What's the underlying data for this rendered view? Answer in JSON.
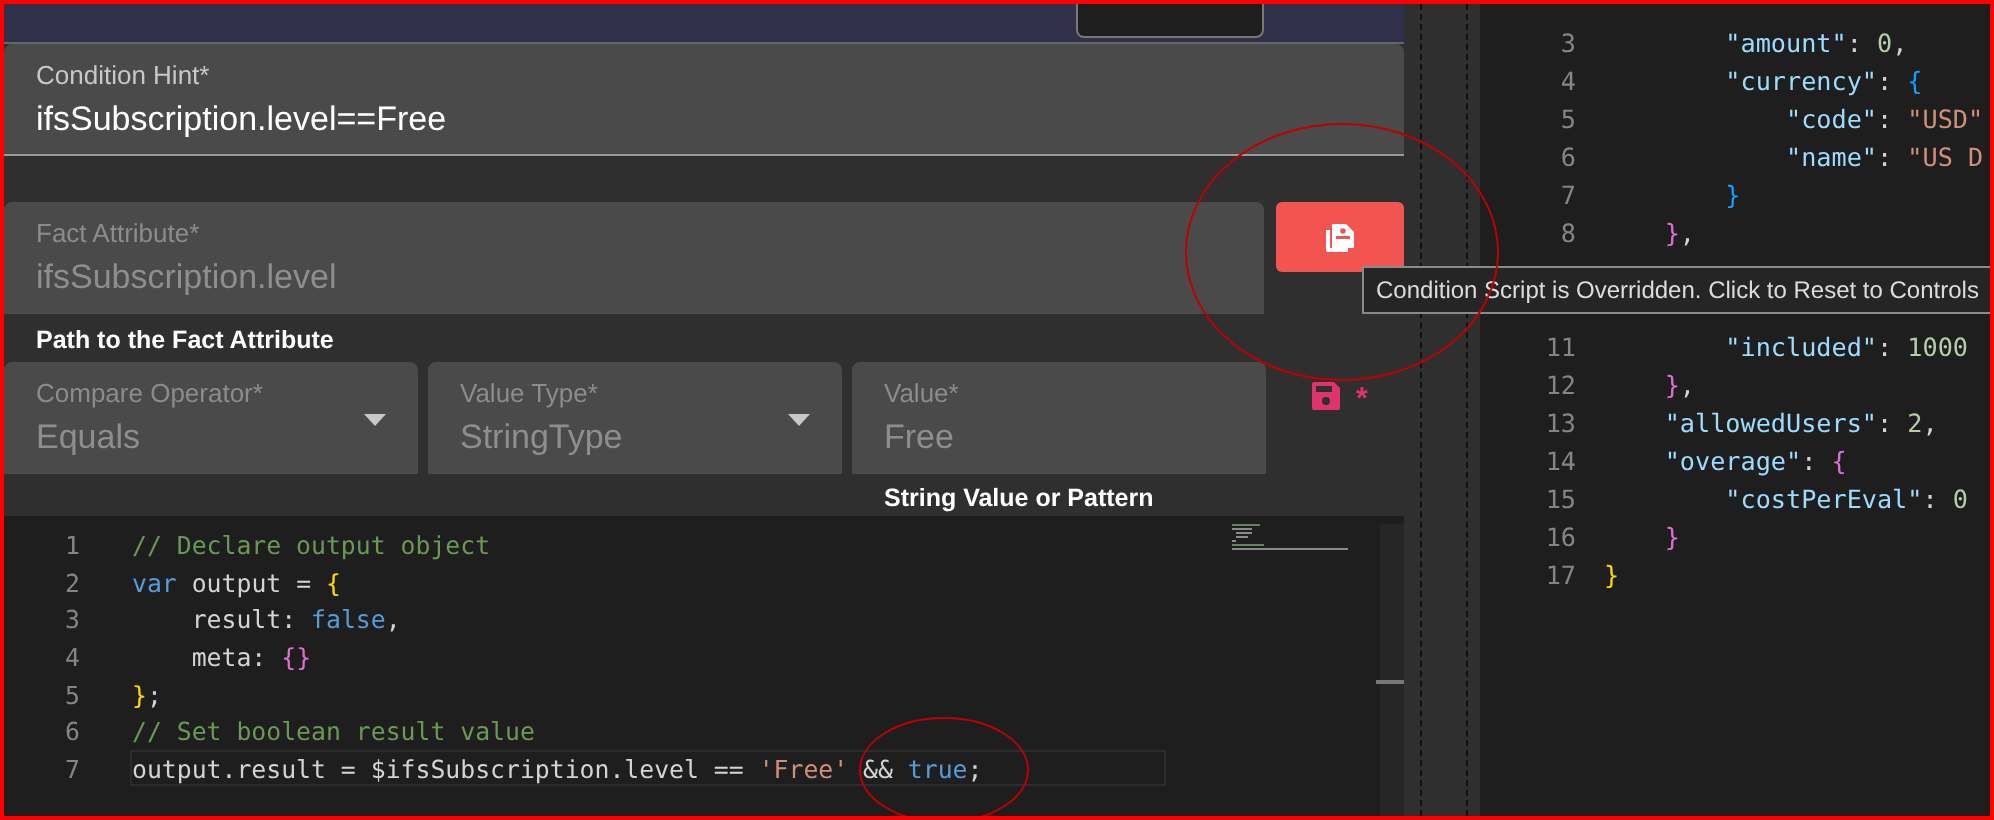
{
  "condition_hint": {
    "label": "Condition Hint*",
    "value": "ifsSubscription.level==Free",
    "disabled": false
  },
  "fact_attribute": {
    "label": "Fact Attribute*",
    "value": "ifsSubscription.level",
    "disabled": true,
    "helper": "Path to the Fact Attribute"
  },
  "reset_button": {
    "tooltip": "Condition Script is Overridden. Click to Reset to Controls"
  },
  "criteria_fields": [
    {
      "label": "Compare Operator*",
      "value": "Equals",
      "disabled": true,
      "kind": "select"
    },
    {
      "label": "Value Type*",
      "value": "StringType",
      "disabled": true,
      "kind": "select"
    },
    {
      "label": "Value*",
      "value": "Free",
      "disabled": true,
      "kind": "text",
      "helper": "String Value or Pattern"
    }
  ],
  "save_marker": "*",
  "script_editor": {
    "lines": [
      {
        "number": "1",
        "current": false,
        "tokens": [
          {
            "kind": "comment",
            "text": "// Declare output object"
          }
        ]
      },
      {
        "number": "2",
        "current": false,
        "tokens": [
          {
            "kind": "keyword",
            "text": "var"
          },
          {
            "kind": "plain",
            "text": " output = "
          },
          {
            "kind": "bracket1",
            "text": "{"
          }
        ]
      },
      {
        "number": "3",
        "current": false,
        "tokens": [
          {
            "kind": "plain",
            "text": "    result: "
          },
          {
            "kind": "keyword",
            "text": "false"
          },
          {
            "kind": "plain",
            "text": ","
          }
        ]
      },
      {
        "number": "4",
        "current": false,
        "tokens": [
          {
            "kind": "plain",
            "text": "    meta: "
          },
          {
            "kind": "bracket2",
            "text": "{}"
          }
        ]
      },
      {
        "number": "5",
        "current": false,
        "tokens": [
          {
            "kind": "bracket1",
            "text": "}"
          },
          {
            "kind": "plain",
            "text": ";"
          }
        ]
      },
      {
        "number": "6",
        "current": false,
        "tokens": [
          {
            "kind": "comment",
            "text": "// Set boolean result value"
          }
        ]
      },
      {
        "number": "7",
        "current": true,
        "tokens": [
          {
            "kind": "plain",
            "text": "output.result = $ifsSubscription.level == "
          },
          {
            "kind": "string",
            "text": "'Free'"
          },
          {
            "kind": "plain",
            "text": " && "
          },
          {
            "kind": "keyword",
            "text": "true"
          },
          {
            "kind": "plain",
            "text": ";"
          }
        ]
      }
    ]
  },
  "json_editor": {
    "lines": [
      {
        "kind": "line",
        "number": "3",
        "tokens": [
          {
            "kind": "key",
            "text": "        \"amount\""
          },
          {
            "kind": "plain",
            "text": ": "
          },
          {
            "kind": "number",
            "text": "0"
          },
          {
            "kind": "plain",
            "text": ","
          }
        ]
      },
      {
        "kind": "line",
        "number": "4",
        "tokens": [
          {
            "kind": "key",
            "text": "        \"currency\""
          },
          {
            "kind": "plain",
            "text": ": "
          },
          {
            "kind": "bracket3",
            "text": "{"
          }
        ]
      },
      {
        "kind": "line",
        "number": "5",
        "tokens": [
          {
            "kind": "key",
            "text": "            \"code\""
          },
          {
            "kind": "plain",
            "text": ": "
          },
          {
            "kind": "string",
            "text": "\"USD\""
          }
        ]
      },
      {
        "kind": "line",
        "number": "6",
        "tokens": [
          {
            "kind": "key",
            "text": "            \"name\""
          },
          {
            "kind": "plain",
            "text": ": "
          },
          {
            "kind": "string",
            "text": "\"US D"
          }
        ]
      },
      {
        "kind": "line",
        "number": "7",
        "tokens": [
          {
            "kind": "bracket3",
            "text": "        }"
          }
        ]
      },
      {
        "kind": "line",
        "number": "8",
        "tokens": [
          {
            "kind": "bracket2",
            "text": "    }"
          },
          {
            "kind": "plain",
            "text": ","
          }
        ]
      },
      {
        "kind": "covered"
      },
      {
        "kind": "covered"
      },
      {
        "kind": "line",
        "number": "11",
        "tokens": [
          {
            "kind": "key",
            "text": "        \"included\""
          },
          {
            "kind": "plain",
            "text": ": "
          },
          {
            "kind": "number",
            "text": "1000"
          }
        ]
      },
      {
        "kind": "line",
        "number": "12",
        "tokens": [
          {
            "kind": "bracket2",
            "text": "    }"
          },
          {
            "kind": "plain",
            "text": ","
          }
        ]
      },
      {
        "kind": "line",
        "number": "13",
        "tokens": [
          {
            "kind": "key",
            "text": "    \"allowedUsers\""
          },
          {
            "kind": "plain",
            "text": ": "
          },
          {
            "kind": "number",
            "text": "2"
          },
          {
            "kind": "plain",
            "text": ","
          }
        ]
      },
      {
        "kind": "line",
        "number": "14",
        "tokens": [
          {
            "kind": "key",
            "text": "    \"overage\""
          },
          {
            "kind": "plain",
            "text": ": "
          },
          {
            "kind": "bracket2",
            "text": "{"
          }
        ]
      },
      {
        "kind": "line",
        "number": "15",
        "tokens": [
          {
            "kind": "key",
            "text": "        \"costPerEval\""
          },
          {
            "kind": "plain",
            "text": ": "
          },
          {
            "kind": "number",
            "text": "0"
          }
        ]
      },
      {
        "kind": "line",
        "number": "16",
        "tokens": [
          {
            "kind": "bracket2",
            "text": "    }"
          }
        ]
      },
      {
        "kind": "line",
        "number": "17",
        "tokens": [
          {
            "kind": "bracket1",
            "text": "}"
          }
        ]
      }
    ]
  }
}
